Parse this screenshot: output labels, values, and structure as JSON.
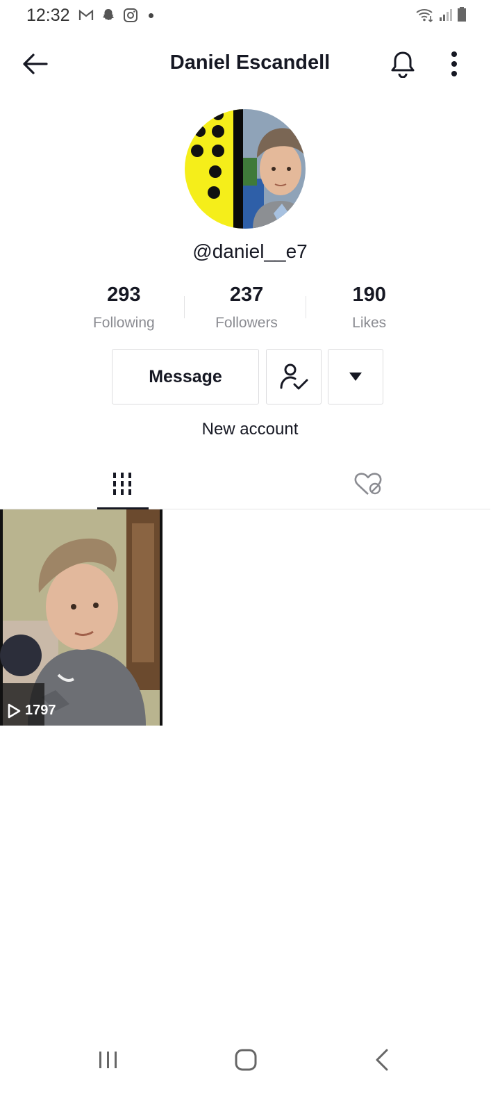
{
  "status_bar": {
    "time": "12:32",
    "icons_left": [
      "gmail-icon",
      "snapchat-icon",
      "instagram-icon",
      "notification-dot"
    ],
    "icons_right": [
      "wifi-icon",
      "signal-icon",
      "battery-icon"
    ]
  },
  "header": {
    "title": "Daniel Escandell"
  },
  "profile": {
    "username": "@daniel__e7",
    "bio": "New account"
  },
  "stats": [
    {
      "value": "293",
      "label": "Following"
    },
    {
      "value": "237",
      "label": "Followers"
    },
    {
      "value": "190",
      "label": "Likes"
    }
  ],
  "actions": {
    "message_label": "Message"
  },
  "videos": [
    {
      "views": "1797"
    }
  ],
  "colors": {
    "text_primary": "#161823",
    "text_secondary": "#8a8b91",
    "border": "#dcdcde",
    "avatar_yellow": "#f5ee1a"
  }
}
